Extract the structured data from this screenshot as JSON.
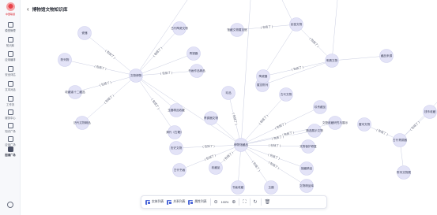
{
  "brand": {
    "logo_text": "中国联通",
    "accent": "#d9232e"
  },
  "page": {
    "title": "博物馆文物知识库"
  },
  "sidebar": {
    "items": [
      {
        "label": "模型管理",
        "icon": "cube-icon",
        "active": false
      },
      {
        "label": "知识库",
        "icon": "book-icon",
        "active": false
      },
      {
        "label": "应用编排",
        "icon": "flow-icon",
        "active": false
      },
      {
        "label": "安全评估",
        "icon": "shield-icon",
        "active": false
      },
      {
        "label": "文本对话",
        "icon": "chat-icon",
        "active": false
      },
      {
        "label": "工作流",
        "icon": "workflow-icon",
        "active": false
      },
      {
        "label": "服务中心",
        "icon": "service-icon",
        "active": false
      },
      {
        "label": "知识广场",
        "icon": "globe-icon",
        "active": false
      },
      {
        "label": "应用广场",
        "icon": "apps-icon",
        "active": false
      },
      {
        "label": "图谱广场",
        "icon": "graph-icon",
        "active": true
      }
    ]
  },
  "graph": {
    "nodes": [
      {
        "id": "n1",
        "label": "瓷器"
      },
      {
        "id": "n2",
        "label": "陈列物"
      },
      {
        "id": "n3",
        "label": "收藏者十二藏品"
      },
      {
        "id": "n4",
        "label": "历代文物精品"
      },
      {
        "id": "n5",
        "label": "文物博物"
      },
      {
        "id": "n6",
        "label": "古代陶瓷文物"
      },
      {
        "id": "n7",
        "label": "青铜器"
      },
      {
        "id": "n8",
        "label": "书画作品精品"
      },
      {
        "id": "n9",
        "label": "馆藏文物展览馆"
      },
      {
        "id": "n10",
        "label": "民窑文物"
      },
      {
        "id": "n11",
        "label": "珍品"
      },
      {
        "id": "n12",
        "label": "玉器精品收藏"
      },
      {
        "id": "n13",
        "label": "清代《古籍》"
      },
      {
        "id": "n14",
        "label": "青铜器文物"
      },
      {
        "id": "n15",
        "label": "展览陈列"
      },
      {
        "id": "n16",
        "label": "陶瓷器"
      },
      {
        "id": "n17",
        "label": "明清文物"
      },
      {
        "id": "n18",
        "label": "藏品来源"
      },
      {
        "id": "n19",
        "label": "古代文物"
      },
      {
        "id": "n20",
        "label": "珍贵藏品"
      },
      {
        "id": "n21",
        "label": "精选展示文物"
      },
      {
        "id": "n22",
        "label": "唐宋文物"
      },
      {
        "id": "n23",
        "label": "文物收藏研究与展示"
      },
      {
        "id": "n24",
        "label": "博物馆藏品"
      },
      {
        "id": "n25",
        "label": "历史文物"
      },
      {
        "id": "n26",
        "label": "古代书画"
      },
      {
        "id": "n27",
        "label": "收藏品"
      },
      {
        "id": "n28",
        "label": "书画收藏"
      },
      {
        "id": "n29",
        "label": "玉器"
      },
      {
        "id": "n30",
        "label": "文物精品库"
      },
      {
        "id": "n31",
        "label": "馆藏精品"
      },
      {
        "id": "n32",
        "label": "文物保护修复"
      },
      {
        "id": "n33",
        "label": "古代青铜器"
      },
      {
        "id": "n34",
        "label": "钱币收藏"
      },
      {
        "id": "n35",
        "label": "陈列文物展"
      }
    ],
    "edge_label": "包括了",
    "edge_labels": [
      "包括了",
      "包括了",
      "包括了",
      "包括了",
      "包括了",
      "包括了",
      "包括了",
      "包括了",
      "包括了",
      "包括了",
      "包括了",
      "包括了",
      "包括了",
      "包括了",
      "包括了",
      "包括了",
      "包括了",
      "包括了",
      "包括了",
      "包括了",
      "包括了",
      "包括了",
      "包括了",
      "包括了"
    ]
  },
  "toolbar": {
    "btn1": "实体列表",
    "btn2": "关系列表",
    "btn3": "属性列表",
    "zoom": "100%"
  }
}
